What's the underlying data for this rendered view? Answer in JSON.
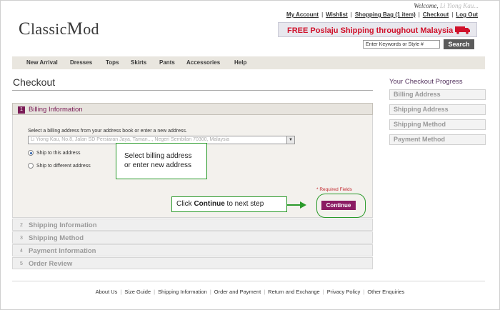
{
  "header": {
    "logo": {
      "first": "C",
      "rest1": "lassic",
      "second": "M",
      "rest2": "od"
    },
    "welcome_prefix": "Welcome,",
    "welcome_name": "Li Yiong Kau...",
    "top_links": [
      "My Account",
      "Wishlist",
      "Shopping Bag (1 item)",
      "Checkout",
      "Log Out"
    ],
    "shipping_banner": "FREE Poslaju Shipping throughout Malaysia",
    "search": {
      "placeholder": "Enter Keywords or Style #",
      "button": "Search"
    }
  },
  "nav": [
    "New Arrival",
    "Dresses",
    "Tops",
    "Skirts",
    "Pants",
    "Accessories",
    "Help"
  ],
  "checkout": {
    "title": "Checkout",
    "progress_title": "Your Checkout Progress",
    "progress_steps": [
      "Billing Address",
      "Shipping Address",
      "Shipping Method",
      "Payment Method"
    ],
    "sections": [
      {
        "num": "1",
        "label": "Billing Information",
        "active": true
      },
      {
        "num": "2",
        "label": "Shipping Information"
      },
      {
        "num": "3",
        "label": "Shipping Method"
      },
      {
        "num": "4",
        "label": "Payment Information"
      },
      {
        "num": "5",
        "label": "Order Review"
      }
    ],
    "billing": {
      "instruction": "Select a billing address from your address book or enter a new address.",
      "selected_address": "Li Yiong Kau, No.8, Jalan SD Persiaran Jaya, Taman..., Negeri Sembilan 70300, Malaysia",
      "ship_option_1": "Ship to this address",
      "ship_option_2": "Ship to different address",
      "ship_selected": 1,
      "required_note": "* Required Fields",
      "continue_label": "Continue"
    },
    "callouts": {
      "select_line1": "Select billing address",
      "select_line2": "or enter new address",
      "continue_prefix": "Click ",
      "continue_bold": "Continue",
      "continue_suffix": " to next step"
    }
  },
  "footer": {
    "links": [
      "About Us",
      "Size Guide",
      "Shipping Information",
      "Order and Payment",
      "Return and Exchange",
      "Privacy Policy",
      "Other Enquiries"
    ]
  },
  "colors": {
    "accent": "#7a1b56",
    "button": "#8b1c63",
    "banner_text": "#d0112b",
    "callout_border": "#2a9a2a"
  }
}
